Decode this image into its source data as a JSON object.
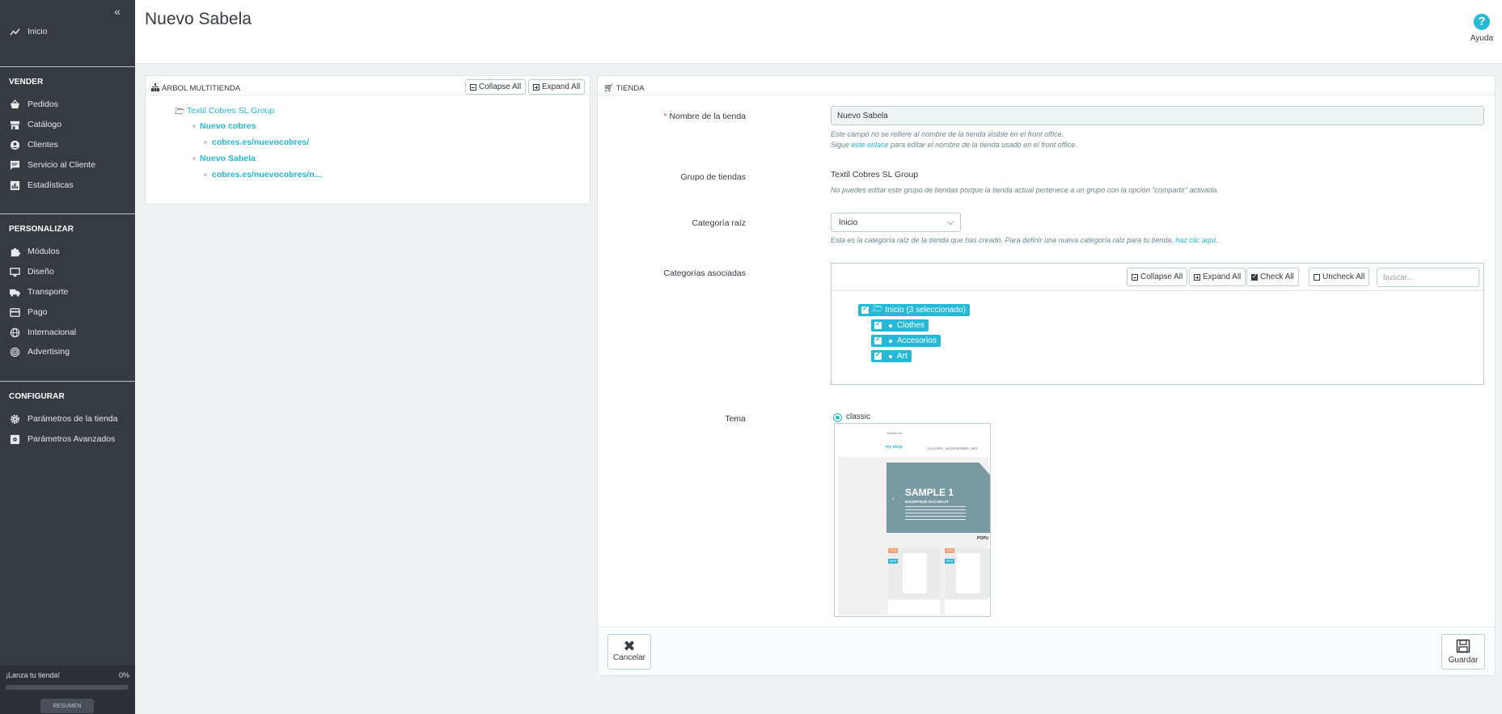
{
  "sidebar": {
    "collapse_icon": "double-chevron-left-icon",
    "home": "Inicio",
    "sections": {
      "sell": "VENDER",
      "customize": "PERSONALIZAR",
      "configure": "CONFIGURAR"
    },
    "sell_items": [
      "Pedidos",
      "Catálogo",
      "Clientes",
      "Servicio al Cliente",
      "Estadísticas"
    ],
    "customize_items": [
      "Módulos",
      "Diseño",
      "Transporte",
      "Pago",
      "Internacional",
      "Advertising"
    ],
    "configure_items": [
      "Parámetros de la tienda",
      "Parámetros Avanzados"
    ],
    "launch": {
      "label": "¡Lanza tu tienda!",
      "percent": "0%",
      "progress": 0,
      "button": "RESUMEN"
    }
  },
  "header": {
    "title": "Nuevo Sabela",
    "help_label": "Ayuda"
  },
  "tree_panel": {
    "title": "ÁRBOL MULTITIENDA",
    "collapse_all": "Collapse All",
    "expand_all": "Expand All",
    "group": "Textil Cobres SL Group",
    "shops": [
      {
        "name": "Nuevo cobres",
        "url": "cobres.es/nuevocobres/"
      },
      {
        "name": "Nuevo Sabela",
        "url": "cobres.es/nuevocobres/n..."
      }
    ]
  },
  "shop_panel": {
    "title": "TIENDA",
    "name_label": "Nombre de la tienda",
    "name_value": "Nuevo Sabela",
    "name_hint_1": "Este campo no se refiere al nombre de la tienda visible en el front office.",
    "name_hint_2_pre": "Sigue ",
    "name_hint_2_link": "este enlace",
    "name_hint_2_post": " para editar el nombre de la tienda usado en el front office.",
    "group_label": "Grupo de tiendas",
    "group_value": "Textil Cobres SL Group",
    "group_hint": "No puedes editar este grupo de tiendas porque la tienda actual pertenece a un grupo con la opción \"compartir\" activada.",
    "root_label": "Categoría raíz",
    "root_value": "Inicio",
    "root_hint_pre": "Esta es la categoría raíz de la tienda que has creado. Para definir una nueva categoría raíz para tu tienda, ",
    "root_hint_link": "haz clic aquí",
    "root_hint_post": ".",
    "assoc_label": "Categorías asociadas",
    "cat_toolbar": {
      "collapse_all": "Collapse All",
      "expand_all": "Expand All",
      "check_all": "Check All",
      "uncheck_all": "Uncheck All",
      "search_placeholder": "buscar..."
    },
    "root_chip": "Inicio (3 seleccionado)",
    "categories": [
      "Clothes",
      "Accesorios",
      "Art"
    ],
    "theme_label": "Tema",
    "theme_value": "classic",
    "theme_preview": {
      "contact": "Contact us",
      "logo": "my shop",
      "menu": "CLOTHES   ACCESSORIES   ART",
      "slide_title": "SAMPLE 1",
      "slide_sub": "EXCEPTEUR OCCAECAT",
      "popular": "POPU",
      "badge_discount": "-20%",
      "badge_new": "NEW"
    },
    "cancel": "Cancelar",
    "save": "Guardar"
  }
}
